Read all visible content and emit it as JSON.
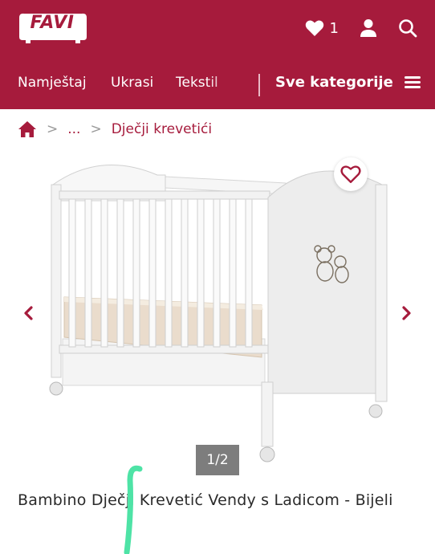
{
  "brand": {
    "logo_text": "FAVI",
    "color": "#a61b3c"
  },
  "header": {
    "wishlist_count": "1",
    "icons": [
      "heart-icon",
      "user-icon",
      "search-icon"
    ]
  },
  "nav": {
    "links": [
      "Namještaj",
      "Ukrasi",
      "Tekstil"
    ],
    "all_categories": "Sve kategorije"
  },
  "breadcrumb": {
    "home_icon": "home-icon",
    "ellipsis": "...",
    "current": "Dječji krevetići"
  },
  "gallery": {
    "counter": "1/2",
    "prev_icon": "chevron-left-icon",
    "next_icon": "chevron-right-icon",
    "wishlist_icon": "heart-outline-icon"
  },
  "product": {
    "title": "Bambino Dječji Krevetić Vendy s Ladicom - Bijeli"
  }
}
